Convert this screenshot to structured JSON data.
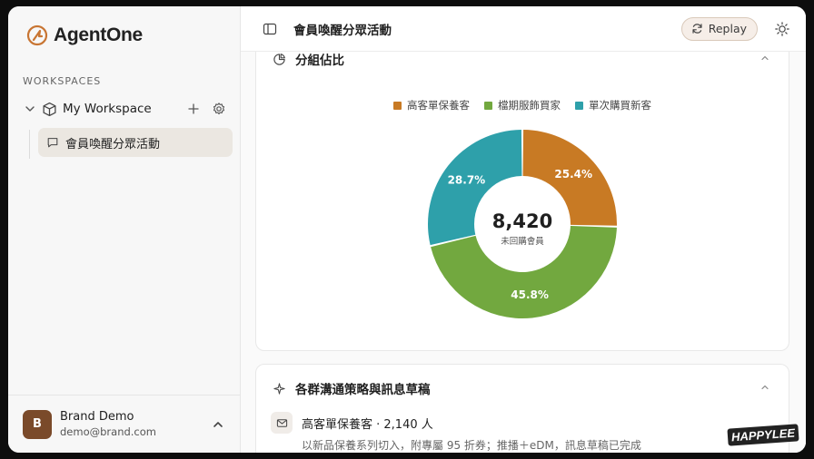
{
  "brand": {
    "name": "AgentOne",
    "accent": "#c87533"
  },
  "sidebar": {
    "section_label": "WORKSPACES",
    "workspace": {
      "name": "My Workspace"
    },
    "chat_item": {
      "label": "會員喚醒分眾活動"
    },
    "user": {
      "initial": "B",
      "name": "Brand Demo",
      "email": "demo@brand.com"
    }
  },
  "topbar": {
    "title": "會員喚醒分眾活動",
    "replay_label": "Replay"
  },
  "card1": {
    "title": "分組佔比",
    "center_value": "8,420",
    "center_label": "未回購會員"
  },
  "chart_data": {
    "type": "pie",
    "donut": true,
    "series": [
      {
        "name": "高客單保養客",
        "value": 25.4,
        "label": "25.4%",
        "color": "#c87a24"
      },
      {
        "name": "檔期服飾買家",
        "value": 45.8,
        "label": "45.8%",
        "color": "#72a83f"
      },
      {
        "name": "單次購買新客",
        "value": 28.7,
        "label": "28.7%",
        "color": "#2ea0aa"
      }
    ],
    "legend": "top-center"
  },
  "card2": {
    "title": "各群溝通策略與訊息草稿",
    "segment": {
      "title": "高客單保養客 · 2,140 人",
      "description": "以新品保養系列切入，附專屬 95 折券；推播＋eDM，訊息草稿已完成"
    }
  },
  "watermark": "HAPPYLEE"
}
